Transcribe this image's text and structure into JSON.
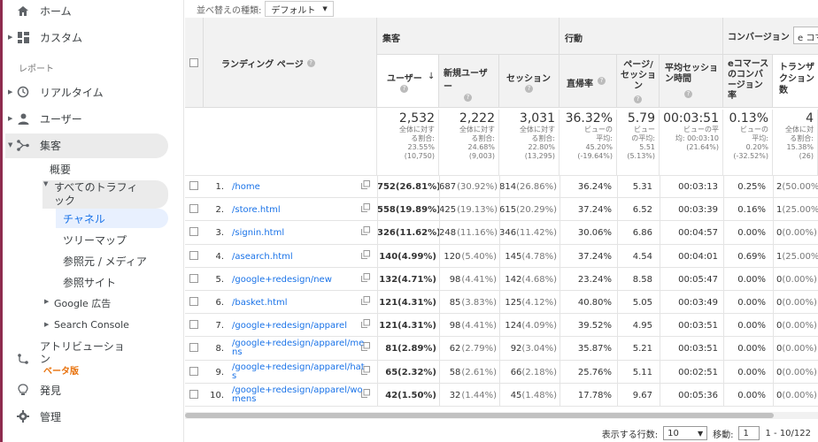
{
  "sidebar": {
    "home": "ホーム",
    "custom": "カスタム",
    "report_section": "レポート",
    "realtime": "リアルタイム",
    "user": "ユーザー",
    "acquisition": "集客",
    "overview": "概要",
    "all_traffic": "すべてのトラフィック",
    "channel": "チャネル",
    "treemap": "ツリーマップ",
    "source_medium": "参照元 / メディア",
    "referrals": "参照サイト",
    "google_ads": "Google 広告",
    "search_console": "Search Console",
    "attribution": "アトリビューション",
    "beta": "ベータ版",
    "discover": "発見",
    "admin": "管理"
  },
  "toolbar": {
    "sort_label": "並べ替えの種類:",
    "sort_value": "デフォルト"
  },
  "table": {
    "dim_header": "ランディング ページ",
    "groups": {
      "acq": "集客",
      "beh": "行動",
      "conv": "コンバージョン",
      "conv_select": "e コマ"
    },
    "columns": {
      "users": "ユーザー",
      "new_users": "新規ユーザー",
      "sessions": "セッション",
      "bounce": "直帰率",
      "pps": "ページ/セッション",
      "duration": "平均セッション時間",
      "ecr": "eコマースのコンバージョン率",
      "tx": "トランザクション数"
    },
    "totals": {
      "users": {
        "v": "2,532",
        "d1": "全体に対す",
        "d2": "る割合:",
        "d3": "23.55%",
        "d4": "(10,750)"
      },
      "new_users": {
        "v": "2,222",
        "d1": "全体に対す",
        "d2": "る割合:",
        "d3": "24.68%",
        "d4": "(9,003)"
      },
      "sessions": {
        "v": "3,031",
        "d1": "全体に対す",
        "d2": "る割合:",
        "d3": "22.80%",
        "d4": "(13,295)"
      },
      "bounce": {
        "v": "36.32%",
        "d1": "ビューの",
        "d2": "平均:",
        "d3": "45.20%",
        "d4": "(-19.64%)"
      },
      "pps": {
        "v": "5.79",
        "d1": "ビュー",
        "d2": "の平均:",
        "d3": "5.51",
        "d4": "(5.13%)"
      },
      "duration": {
        "v": "00:03:51",
        "d1": "ビューの平",
        "d2": "均: 00:03:10",
        "d3": "(21.64%)",
        "d4": ""
      },
      "ecr": {
        "v": "0.13%",
        "d1": "ビューの",
        "d2": "平均:",
        "d3": "0.20%",
        "d4": "(-32.52%)"
      },
      "tx": {
        "v": "4",
        "d1": "全体に対",
        "d2": "る割合:",
        "d3": "15.38%",
        "d4": "(26)"
      }
    },
    "rows": [
      {
        "n": "1.",
        "page": "/home",
        "u": "752",
        "up": "(26.81%)",
        "nu": "687",
        "nup": "(30.92%)",
        "s": "814",
        "sp": "(26.86%)",
        "b": "36.24%",
        "pps": "5.31",
        "d": "00:03:13",
        "e": "0.25%",
        "t": "2",
        "tp": "(50.00%)"
      },
      {
        "n": "2.",
        "page": "/store.html",
        "u": "558",
        "up": "(19.89%)",
        "nu": "425",
        "nup": "(19.13%)",
        "s": "615",
        "sp": "(20.29%)",
        "b": "37.24%",
        "pps": "6.52",
        "d": "00:03:39",
        "e": "0.16%",
        "t": "1",
        "tp": "(25.00%)"
      },
      {
        "n": "3.",
        "page": "/signin.html",
        "u": "326",
        "up": "(11.62%)",
        "nu": "248",
        "nup": "(11.16%)",
        "s": "346",
        "sp": "(11.42%)",
        "b": "30.06%",
        "pps": "6.86",
        "d": "00:04:57",
        "e": "0.00%",
        "t": "0",
        "tp": "(0.00%)"
      },
      {
        "n": "4.",
        "page": "/asearch.html",
        "u": "140",
        "up": "(4.99%)",
        "nu": "120",
        "nup": "(5.40%)",
        "s": "145",
        "sp": "(4.78%)",
        "b": "37.24%",
        "pps": "4.54",
        "d": "00:04:01",
        "e": "0.69%",
        "t": "1",
        "tp": "(25.00%)"
      },
      {
        "n": "5.",
        "page": "/google+redesign/new",
        "u": "132",
        "up": "(4.71%)",
        "nu": "98",
        "nup": "(4.41%)",
        "s": "142",
        "sp": "(4.68%)",
        "b": "23.24%",
        "pps": "8.58",
        "d": "00:05:47",
        "e": "0.00%",
        "t": "0",
        "tp": "(0.00%)"
      },
      {
        "n": "6.",
        "page": "/basket.html",
        "u": "121",
        "up": "(4.31%)",
        "nu": "85",
        "nup": "(3.83%)",
        "s": "125",
        "sp": "(4.12%)",
        "b": "40.80%",
        "pps": "5.05",
        "d": "00:03:49",
        "e": "0.00%",
        "t": "0",
        "tp": "(0.00%)"
      },
      {
        "n": "7.",
        "page": "/google+redesign/apparel",
        "u": "121",
        "up": "(4.31%)",
        "nu": "98",
        "nup": "(4.41%)",
        "s": "124",
        "sp": "(4.09%)",
        "b": "39.52%",
        "pps": "4.95",
        "d": "00:03:51",
        "e": "0.00%",
        "t": "0",
        "tp": "(0.00%)"
      },
      {
        "n": "8.",
        "page": "/google+redesign/apparel/mens",
        "u": "81",
        "up": "(2.89%)",
        "nu": "62",
        "nup": "(2.79%)",
        "s": "92",
        "sp": "(3.04%)",
        "b": "35.87%",
        "pps": "5.21",
        "d": "00:03:51",
        "e": "0.00%",
        "t": "0",
        "tp": "(0.00%)"
      },
      {
        "n": "9.",
        "page": "/google+redesign/apparel/hats",
        "u": "65",
        "up": "(2.32%)",
        "nu": "58",
        "nup": "(2.61%)",
        "s": "66",
        "sp": "(2.18%)",
        "b": "25.76%",
        "pps": "5.11",
        "d": "00:02:51",
        "e": "0.00%",
        "t": "0",
        "tp": "(0.00%)"
      },
      {
        "n": "10.",
        "page": "/google+redesign/apparel/womens",
        "u": "42",
        "up": "(1.50%)",
        "nu": "32",
        "nup": "(1.44%)",
        "s": "45",
        "sp": "(1.48%)",
        "b": "17.78%",
        "pps": "9.67",
        "d": "00:05:36",
        "e": "0.00%",
        "t": "0",
        "tp": "(0.00%)"
      }
    ]
  },
  "footer": {
    "rows_label": "表示する行数:",
    "rows_value": "10",
    "goto_label": "移動:",
    "goto_value": "1",
    "range": "1 - 10/122"
  },
  "colors": {
    "accent": "#8e2b4e",
    "link": "#1a73e8",
    "beta": "#e8710a"
  }
}
